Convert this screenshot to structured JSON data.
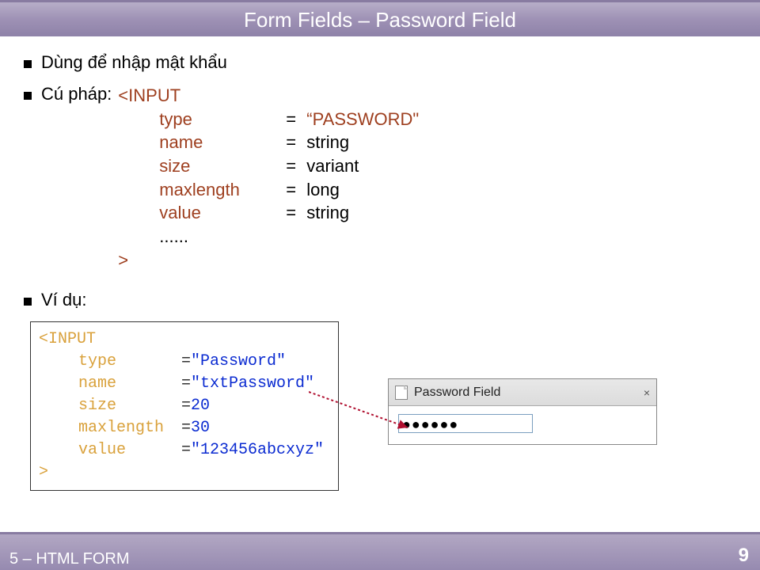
{
  "title": "Form Fields – Password Field",
  "bullets": {
    "line1": "Dùng để nhập mật khẩu",
    "line2_label": "Cú pháp:",
    "line3_label": "Ví dụ:"
  },
  "syntax": {
    "open": "<INPUT",
    "attrs": [
      {
        "name": "type",
        "eq": "=",
        "val_pre": "“",
        "val": "PASSWORD\"",
        "quoted": true
      },
      {
        "name": "name",
        "eq": "=",
        "val": "string"
      },
      {
        "name": "size",
        "eq": "=",
        "val": "variant"
      },
      {
        "name": "maxlength",
        "eq": "=",
        "val": "long"
      },
      {
        "name": "value",
        "eq": "=",
        "val": "string"
      }
    ],
    "dots": "......",
    "close": ">"
  },
  "example": {
    "open": "<INPUT",
    "rows": [
      {
        "name": "type",
        "eq": "=",
        "val": "\"Password\"",
        "kind": "str"
      },
      {
        "name": "name",
        "eq": "=",
        "val": "\"txtPassword\"",
        "kind": "str"
      },
      {
        "name": "size",
        "eq": "=",
        "val": "20",
        "kind": "num"
      },
      {
        "name": "maxlength",
        "eq": "=",
        "val": "30",
        "kind": "num"
      },
      {
        "name": "value",
        "eq": "=",
        "val": "\"123456abcxyz\"",
        "kind": "str"
      }
    ],
    "close": ">"
  },
  "browser": {
    "tab_label": "Password Field",
    "tab_close": "×",
    "pwd_display": "●●●●●●"
  },
  "footer": {
    "left": "5 – HTML FORM",
    "page": "9"
  }
}
